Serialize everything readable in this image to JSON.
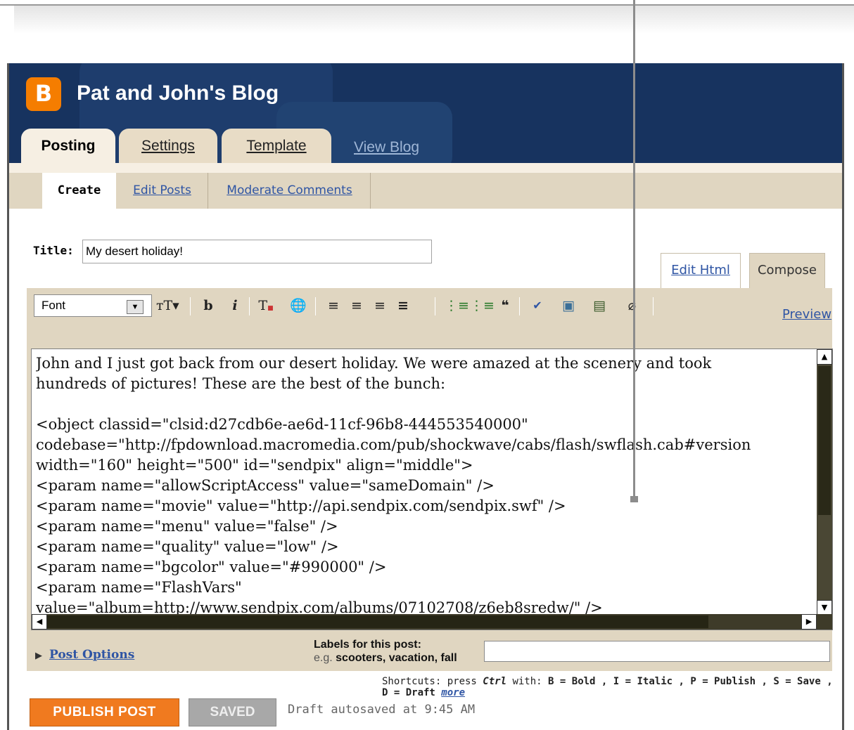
{
  "blog": {
    "title": "Pat and John's Blog",
    "logo_letter": "B"
  },
  "tabs": {
    "posting": "Posting",
    "settings": "Settings",
    "template": "Template",
    "view_blog": "View Blog"
  },
  "subnav": {
    "create": "Create",
    "edit_posts": "Edit Posts",
    "moderate_comments": "Moderate Comments"
  },
  "editor": {
    "title_label": "Title:",
    "title_value": "My desert holiday!",
    "mode_edit_html": "Edit Html",
    "mode_compose": "Compose",
    "font_select": "Font",
    "preview": "Preview",
    "body_lines": [
      "John and I just got back from our desert holiday. We were amazed at the scenery and took",
      "hundreds of pictures! These are the best of the bunch:",
      "",
      "<object classid=\"clsid:d27cdb6e-ae6d-11cf-96b8-444553540000\"",
      "codebase=\"http://fpdownload.macromedia.com/pub/shockwave/cabs/flash/swflash.cab#version",
      "width=\"160\" height=\"500\" id=\"sendpix\" align=\"middle\">",
      "<param name=\"allowScriptAccess\" value=\"sameDomain\" />",
      "<param name=\"movie\" value=\"http://api.sendpix.com/sendpix.swf\" />",
      "<param name=\"menu\" value=\"false\" />",
      "<param name=\"quality\" value=\"low\" />",
      "<param name=\"bgcolor\" value=\"#990000\" />",
      "<param name=\"FlashVars\"",
      "value=\"album=http://www.sendpix.com/albums/07102708/z6eb8sredw/\" />"
    ]
  },
  "toolbar_icons": [
    "font-size-icon",
    "bold-icon",
    "italic-icon",
    "text-color-icon",
    "link-icon",
    "align-left-icon",
    "align-center-icon",
    "align-right-icon",
    "justify-icon",
    "numbered-list-icon",
    "bullet-list-icon",
    "blockquote-icon",
    "spellcheck-icon",
    "image-icon",
    "video-icon",
    "remove-formatting-icon"
  ],
  "post_options": "Post Options",
  "labels": {
    "title": "Labels for this post:",
    "eg_prefix": "e.g.",
    "eg_examples": "scooters, vacation, fall"
  },
  "shortcuts": {
    "prefix": "Shortcuts: press",
    "ctrl": "Ctrl",
    "with": "with:",
    "items": "B = Bold , I = Italic , P = Publish , S = Save , D = Draft",
    "more": "more"
  },
  "actions": {
    "publish": "PUBLISH POST",
    "saved": "SAVED",
    "autosave": "Draft autosaved at 9:45 AM"
  },
  "colors": {
    "header": "#17335f",
    "accent": "#f07a1f",
    "panel": "#e0d6c1",
    "link": "#2f55a4"
  }
}
